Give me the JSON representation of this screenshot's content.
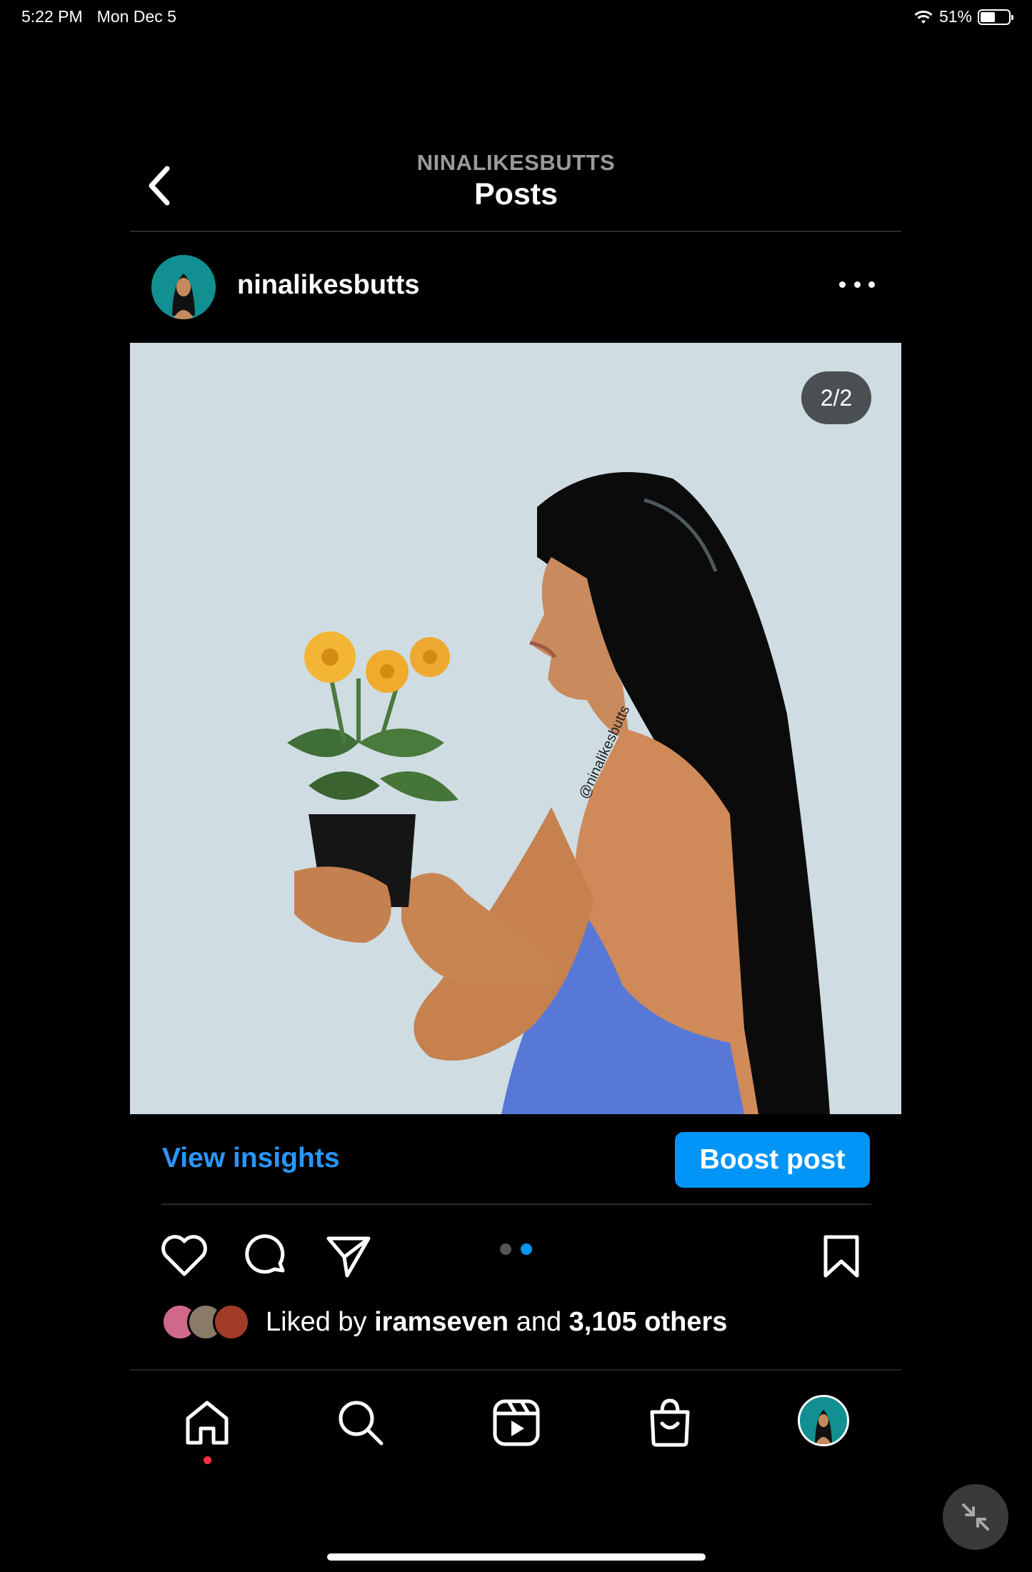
{
  "status_bar": {
    "time": "5:22 PM",
    "date": "Mon Dec 5",
    "battery": "51%",
    "battery_level": 0.51
  },
  "header": {
    "username": "NINALIKESBUTTS",
    "title": "Posts"
  },
  "post": {
    "username": "ninalikesbutts",
    "image_counter": "2/2",
    "image_description_icon": "illustration-woman-holding-flowers",
    "signature_text": "@ninalikesbutts",
    "insights_label": "View insights",
    "boost_label": "Boost post",
    "carousel_index": 2,
    "carousel_total": 2,
    "likes": {
      "prefix": "Liked by",
      "user": "iramseven",
      "middle": "and",
      "count": "3,105 others"
    }
  },
  "nav": {
    "items": [
      "home-icon",
      "search-icon",
      "reels-icon",
      "shop-icon",
      "profile-avatar"
    ]
  },
  "colors": {
    "accent": "#0095f6",
    "link": "#2997ff",
    "notification": "#ff3040",
    "post_bg": "#cfdde3"
  }
}
